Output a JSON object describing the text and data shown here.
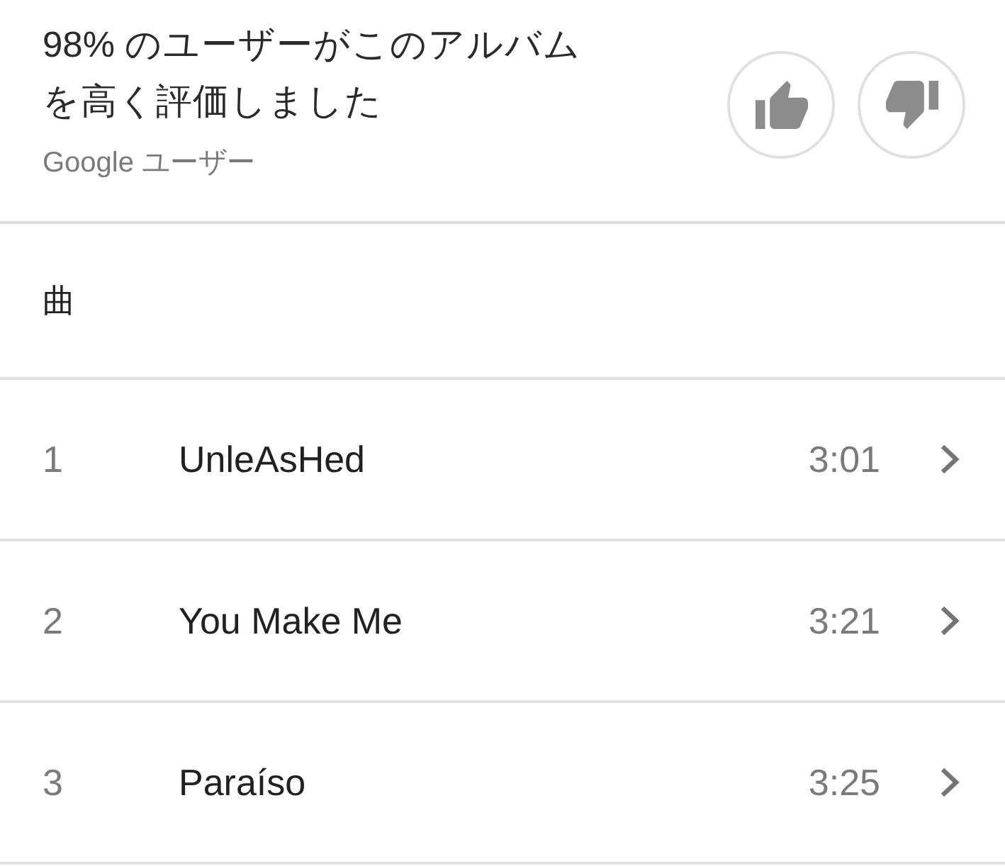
{
  "rating": {
    "summary_lines": [
      "98% のユーザーがこのアルバム",
      "を高く評価しました"
    ],
    "source": "Google ユーザー"
  },
  "rating_buttons": [
    {
      "kind": "like",
      "selected": false
    },
    {
      "kind": "dislike",
      "selected": false
    }
  ],
  "tracks_header": "曲",
  "tracks": [
    {
      "number": "1",
      "title": "UnleAsHed",
      "duration": "3:01"
    },
    {
      "number": "2",
      "title": "You Make Me",
      "duration": "3:21"
    },
    {
      "number": "3",
      "title": "Paraíso",
      "duration": "3:25"
    }
  ]
}
